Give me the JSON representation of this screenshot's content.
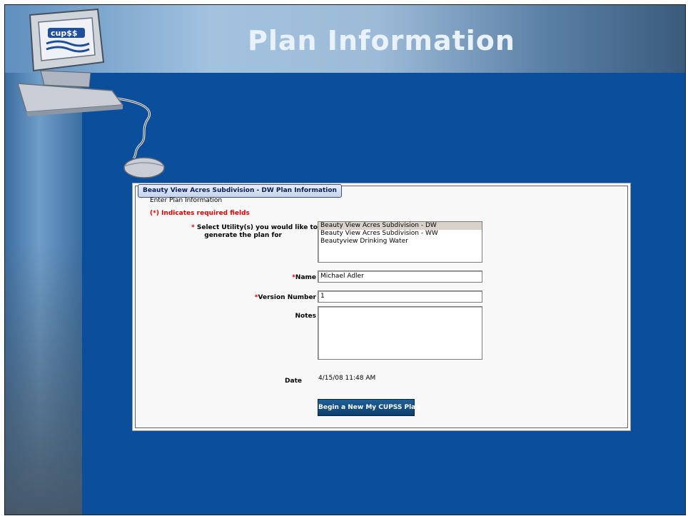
{
  "slide": {
    "title": "Plan Information",
    "logo_text": "cup$$"
  },
  "form": {
    "tab_title": "Beauty View Acres Subdivision - DW Plan Information",
    "subtitle": "Enter Plan Information",
    "required_note": "(*) Indicates required fields",
    "required_marker": "*",
    "utility_label_line1": "Select Utility(s) you would like to",
    "utility_label_line2": "generate the plan for",
    "utility_options": [
      "Beauty View Acres Subdivision - DW",
      "Beauty View Acres Subdivision - WW",
      "Beautyview Drinking Water"
    ],
    "name_label": "Name",
    "name_value": "Michael Adler",
    "version_label": "Version Number",
    "version_value": "1",
    "notes_label": "Notes",
    "notes_value": "",
    "date_label": "Date",
    "date_value": "4/15/08 11:48 AM",
    "submit_label": "Begin a New My CUPSS Plan"
  },
  "colors": {
    "background": "#0b4e9c",
    "required": "#e00000",
    "button": "#0d3f6e"
  }
}
